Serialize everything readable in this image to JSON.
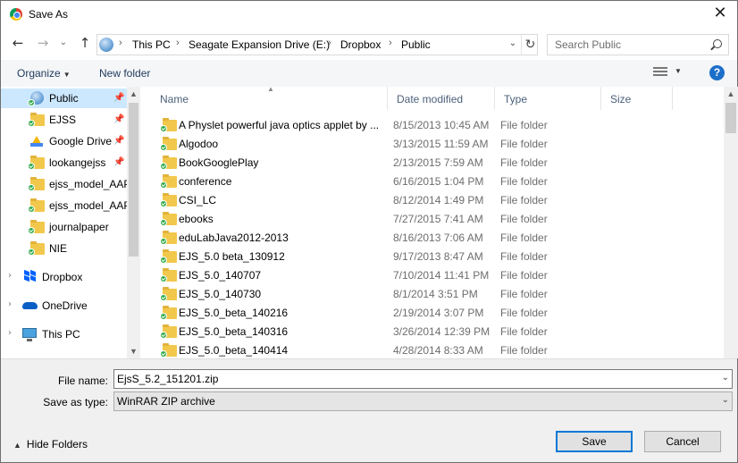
{
  "window": {
    "title": "Save As",
    "close_glyph": "✕"
  },
  "nav": {
    "back_glyph": "←",
    "forward_glyph": "→",
    "recent_glyph": "⌄",
    "up_glyph": "↑",
    "breadcrumbs": [
      "This PC",
      "Seagate Expansion Drive (E:)",
      "Dropbox",
      "Public"
    ],
    "refresh_glyph": "↻",
    "search_placeholder": "Search Public"
  },
  "commands": {
    "organize": "Organize",
    "new_folder": "New folder",
    "help": "?"
  },
  "sidebar": {
    "quick_access": [
      {
        "label": "Public",
        "icon": "globe-icon",
        "selected": true
      },
      {
        "label": "EJSS",
        "icon": "folder-icon"
      },
      {
        "label": "Google Drive",
        "icon": "google-drive-icon"
      },
      {
        "label": "lookangejss",
        "icon": "folder-icon"
      },
      {
        "label": "ejss_model_AAP",
        "icon": "folder-icon"
      },
      {
        "label": "ejss_model_AAP",
        "icon": "folder-icon"
      },
      {
        "label": "journalpaper",
        "icon": "folder-icon"
      },
      {
        "label": "NIE",
        "icon": "folder-icon"
      }
    ],
    "tree": [
      {
        "label": "Dropbox",
        "icon": "dropbox-icon"
      },
      {
        "label": "OneDrive",
        "icon": "onedrive-icon"
      },
      {
        "label": "This PC",
        "icon": "computer-icon"
      }
    ]
  },
  "columns": {
    "name": "Name",
    "date": "Date modified",
    "type": "Type",
    "size": "Size"
  },
  "files": [
    {
      "name": "A Physlet powerful java optics applet by ...",
      "date": "8/15/2013 10:45 AM",
      "type": "File folder"
    },
    {
      "name": "Algodoo",
      "date": "3/13/2015 11:59 AM",
      "type": "File folder"
    },
    {
      "name": "BookGooglePlay",
      "date": "2/13/2015 7:59 AM",
      "type": "File folder"
    },
    {
      "name": "conference",
      "date": "6/16/2015 1:04 PM",
      "type": "File folder"
    },
    {
      "name": "CSI_LC",
      "date": "8/12/2014 1:49 PM",
      "type": "File folder"
    },
    {
      "name": "ebooks",
      "date": "7/27/2015 7:41 AM",
      "type": "File folder"
    },
    {
      "name": "eduLabJava2012-2013",
      "date": "8/16/2013 7:06 AM",
      "type": "File folder"
    },
    {
      "name": "EJS_5.0 beta_130912",
      "date": "9/17/2013 8:47 AM",
      "type": "File folder"
    },
    {
      "name": "EJS_5.0_140707",
      "date": "7/10/2014 11:41 PM",
      "type": "File folder"
    },
    {
      "name": "EJS_5.0_140730",
      "date": "8/1/2014 3:51 PM",
      "type": "File folder"
    },
    {
      "name": "EJS_5.0_beta_140216",
      "date": "2/19/2014 3:07 PM",
      "type": "File folder"
    },
    {
      "name": "EJS_5.0_beta_140316",
      "date": "3/26/2014 12:39 PM",
      "type": "File folder"
    },
    {
      "name": "EJS_5.0_beta_140414",
      "date": "4/28/2014 8:33 AM",
      "type": "File folder"
    }
  ],
  "bottom": {
    "filename_label": "File name:",
    "filename_value": "EjsS_5.2_151201.zip",
    "savetype_label": "Save as type:",
    "savetype_value": "WinRAR ZIP archive",
    "hide_folders": "Hide Folders",
    "save": "Save",
    "cancel": "Cancel"
  }
}
